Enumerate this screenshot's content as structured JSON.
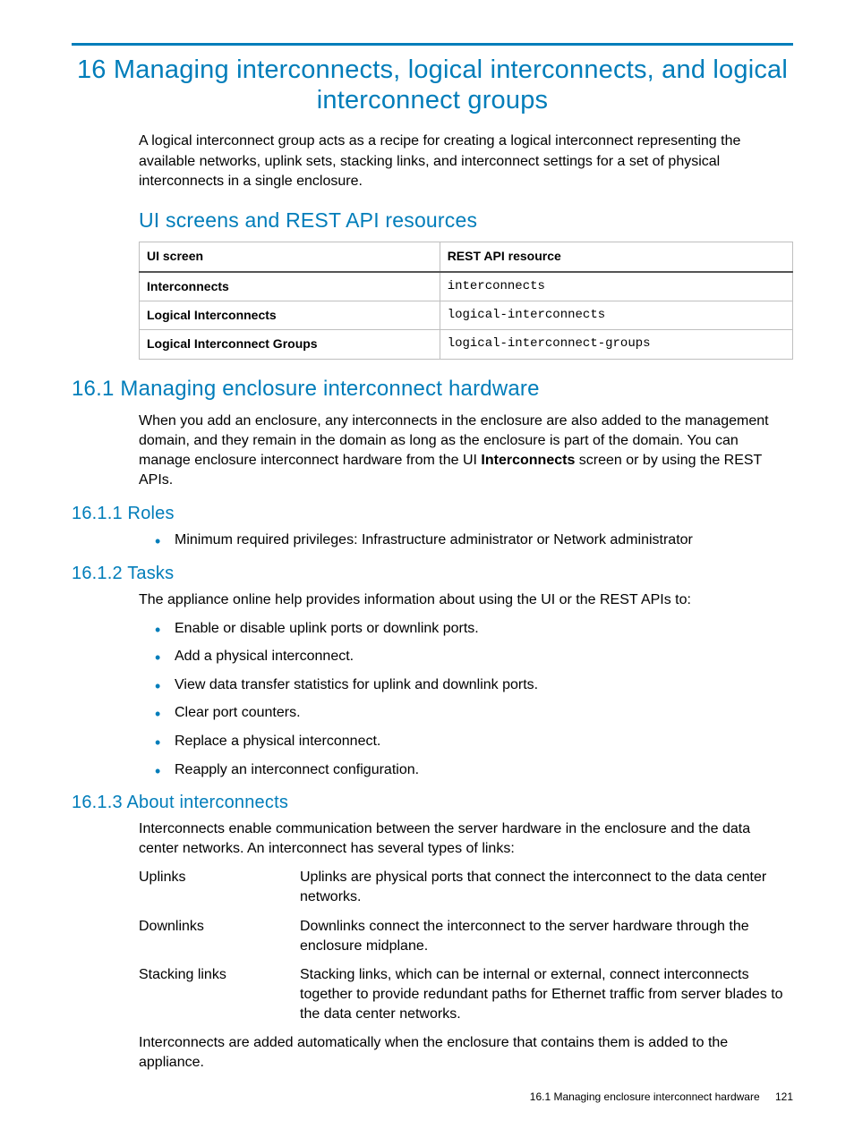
{
  "title": "16 Managing interconnects, logical interconnects, and logical interconnect groups",
  "intro": "A logical interconnect group acts as a recipe for creating a logical interconnect representing the available networks, uplink sets, stacking links, and interconnect settings for a set of physical interconnects in a single enclosure.",
  "sec_ui": {
    "heading": "UI screens and REST API resources",
    "table": {
      "head": [
        "UI screen",
        "REST API resource"
      ],
      "rows": [
        [
          "Interconnects",
          "interconnects"
        ],
        [
          "Logical Interconnects",
          "logical-interconnects"
        ],
        [
          "Logical Interconnect Groups",
          "logical-interconnect-groups"
        ]
      ]
    }
  },
  "sec161": {
    "heading": "16.1 Managing enclosure interconnect hardware",
    "para_pre": "When you add an enclosure, any interconnects in the enclosure are also added to the management domain, and they remain in the domain as long as the enclosure is part of the domain. You can manage enclosure interconnect hardware from the UI ",
    "para_bold": "Interconnects",
    "para_post": " screen or by using the REST APIs."
  },
  "sec1611": {
    "heading": "16.1.1 Roles",
    "items": [
      "Minimum required privileges: Infrastructure administrator or Network administrator"
    ]
  },
  "sec1612": {
    "heading": "16.1.2 Tasks",
    "lead": "The appliance online help provides information about using the UI or the REST APIs to:",
    "items": [
      "Enable or disable uplink ports or downlink ports.",
      "Add a physical interconnect.",
      "View data transfer statistics for uplink and downlink ports.",
      "Clear port counters.",
      "Replace a physical interconnect.",
      "Reapply an interconnect configuration."
    ]
  },
  "sec1613": {
    "heading": "16.1.3 About interconnects",
    "lead": "Interconnects enable communication between the server hardware in the enclosure and the data center networks. An interconnect has several types of links:",
    "defs": [
      {
        "term": "Uplinks",
        "desc": "Uplinks are physical ports that connect the interconnect to the data center networks."
      },
      {
        "term": "Downlinks",
        "desc": "Downlinks connect the interconnect to the server hardware through the enclosure midplane."
      },
      {
        "term": "Stacking links",
        "desc": "Stacking links, which can be internal or external, connect interconnects together to provide redundant paths for Ethernet traffic from server blades to the data center networks."
      }
    ],
    "trail": "Interconnects are added automatically when the enclosure that contains them is added to the appliance."
  },
  "footer": {
    "label": "16.1 Managing enclosure interconnect hardware",
    "page": "121"
  }
}
